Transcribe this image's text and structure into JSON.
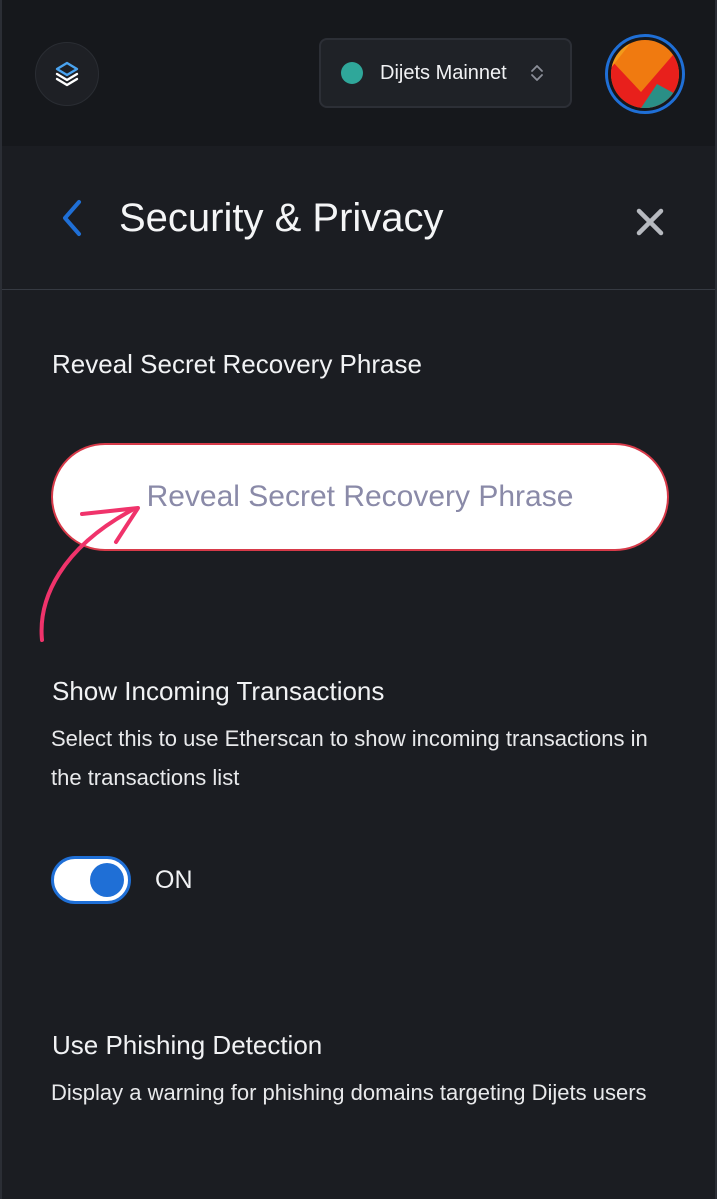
{
  "header": {
    "network": {
      "label": "Dijets Mainnet",
      "dot_color": "#2fa79a"
    },
    "logo_icon": "layers-logo-icon",
    "avatar_icon": "account-identicon"
  },
  "page": {
    "title": "Security & Privacy",
    "back_icon": "chevron-left-icon",
    "close_icon": "close-icon"
  },
  "sections": {
    "reveal": {
      "title": "Reveal Secret Recovery Phrase",
      "button_label": "Reveal Secret Recovery Phrase"
    },
    "incoming": {
      "title": "Show Incoming Transactions",
      "description": "Select this to use Etherscan to show incoming transactions in the transactions list",
      "toggle_state": "ON"
    },
    "phishing": {
      "title": "Use Phishing Detection",
      "description": "Display a warning for phishing domains targeting Dijets users"
    }
  },
  "colors": {
    "accent": "#1f6fd6",
    "danger_border": "#d73a49",
    "annotation": "#f0336b",
    "background": "#1b1d22"
  }
}
